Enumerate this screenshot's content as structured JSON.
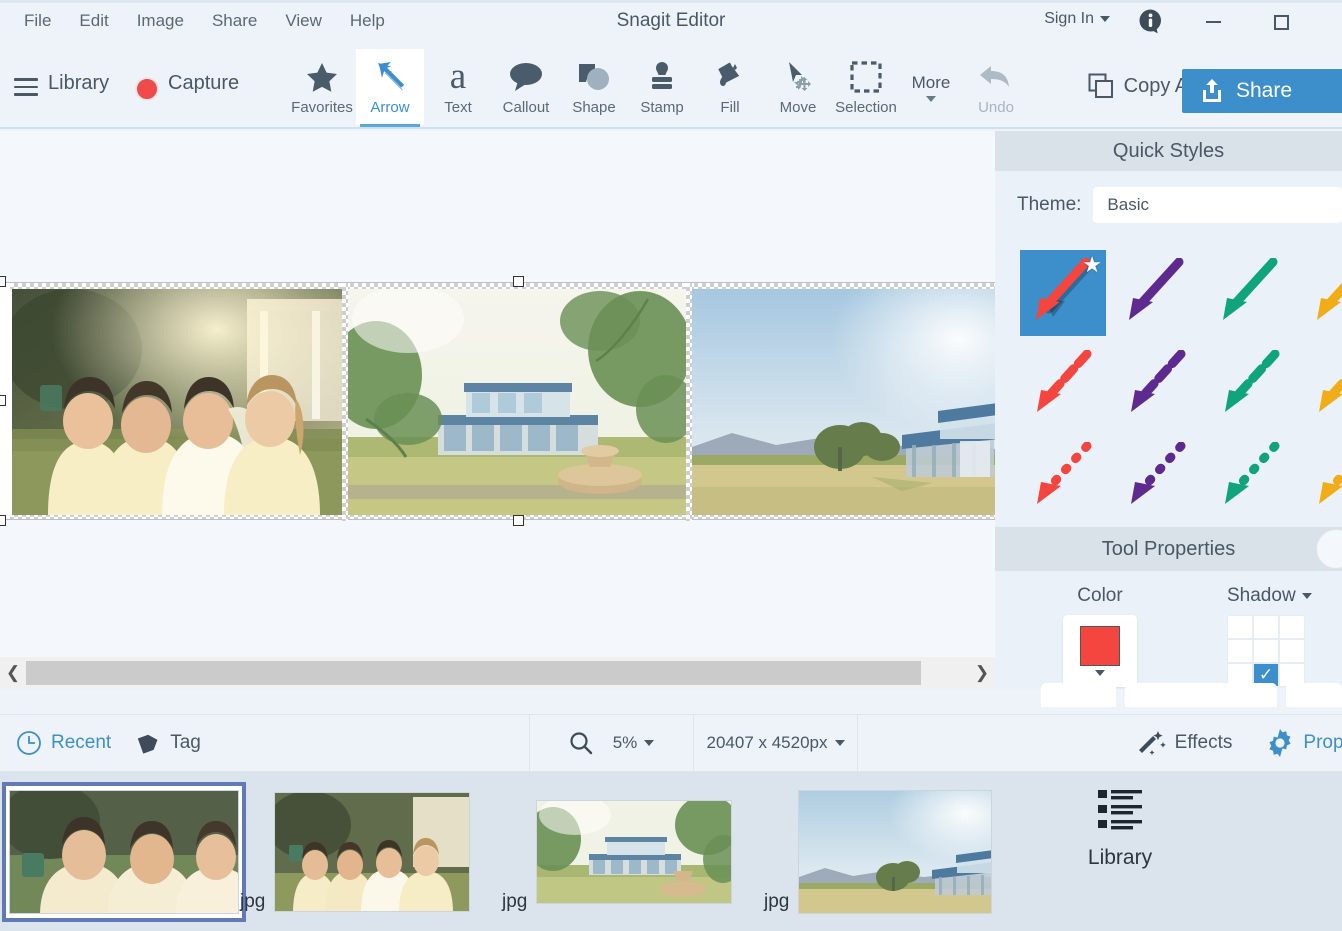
{
  "window": {
    "title": "Snagit Editor",
    "menu": [
      "File",
      "Edit",
      "Image",
      "Share",
      "View",
      "Help"
    ],
    "sign_in": "Sign In",
    "info_icon": "info-icon",
    "minimize": "minimize-button",
    "maximize": "maximize-button"
  },
  "toolbar": {
    "library": "Library",
    "capture": "Capture",
    "tools": [
      {
        "label": "Favorites",
        "icon": "star-icon",
        "active": false
      },
      {
        "label": "Arrow",
        "icon": "arrow-icon",
        "active": true
      },
      {
        "label": "Text",
        "icon": "text-a-icon",
        "active": false
      },
      {
        "label": "Callout",
        "icon": "callout-bubble-icon",
        "active": false
      },
      {
        "label": "Shape",
        "icon": "shape-icon",
        "active": false
      },
      {
        "label": "Stamp",
        "icon": "stamp-icon",
        "active": false
      },
      {
        "label": "Fill",
        "icon": "paint-bucket-icon",
        "active": false
      },
      {
        "label": "Move",
        "icon": "move-cursor-icon",
        "active": false
      },
      {
        "label": "Selection",
        "icon": "marquee-selection-icon",
        "active": false
      }
    ],
    "more": "More",
    "undo": "Undo",
    "copy_all": "Copy All",
    "share": "Share"
  },
  "quick_styles": {
    "heading": "Quick Styles",
    "theme_label": "Theme:",
    "theme_value": "Basic",
    "selected_style_index": 0,
    "rows": [
      {
        "style": "solid",
        "colors": [
          "#f4453f",
          "#5f2a8f",
          "#0fa47a",
          "#f0ad18"
        ]
      },
      {
        "style": "dashed",
        "colors": [
          "#f4453f",
          "#5f2a8f",
          "#0fa47a",
          "#f0ad18"
        ]
      },
      {
        "style": "dotted",
        "colors": [
          "#f4453f",
          "#5f2a8f",
          "#0fa47a",
          "#f0ad18"
        ]
      }
    ]
  },
  "tool_properties": {
    "heading": "Tool Properties",
    "color_label": "Color",
    "color_value": "#f4453f",
    "shadow_label": "Shadow",
    "shadow_selected_cell": "bottom-center"
  },
  "status_bar": {
    "recent": "Recent",
    "tag": "Tag",
    "zoom": "5%",
    "dimensions": "20407 x 4520px",
    "effects": "Effects",
    "properties": "Properties"
  },
  "filmstrip": {
    "items": [
      {
        "ext": "",
        "selected": true,
        "name": "wedding-group-closeup"
      },
      {
        "ext": "jpg",
        "selected": false,
        "name": "wedding-group"
      },
      {
        "ext": "jpg",
        "selected": false,
        "name": "pavilion-fountain"
      },
      {
        "ext": "jpg",
        "selected": false,
        "name": "field-landscape"
      }
    ],
    "library_label": "Library"
  },
  "canvas": {
    "scroll_left": "scroll-left-arrow",
    "scroll_right": "scroll-right-arrow"
  },
  "colors": {
    "accent": "#3d8fcc",
    "panel_header": "#d9e1e9",
    "chrome": "#eef3f9",
    "filmstrip": "#dbe3ec",
    "text": "#4a5866"
  }
}
